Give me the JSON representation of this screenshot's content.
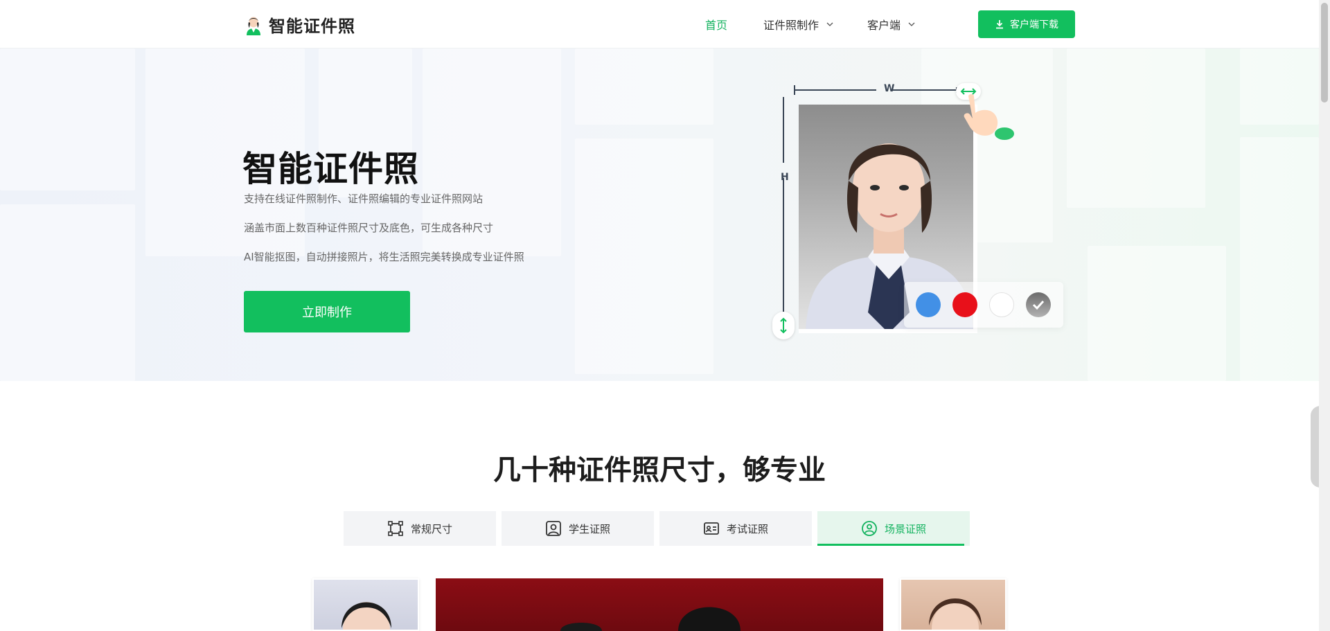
{
  "header": {
    "logo_text": "智能证件照",
    "nav": [
      {
        "label": "首页",
        "active": true
      },
      {
        "label": "证件照制作",
        "dropdown": true
      },
      {
        "label": "客户端",
        "dropdown": true
      }
    ],
    "download_label": "客户端下载"
  },
  "hero": {
    "title": "智能证件照",
    "lines": [
      "支持在线证件照制作、证件照编辑的专业证件照网站",
      "涵盖市面上数百种证件照尺寸及底色，可生成各种尺寸",
      "AI智能抠图，自动拼接照片，将生活照完美转换成专业证件照"
    ],
    "cta_label": "立即制作",
    "illustration": {
      "width_label": "W",
      "height_label": "H",
      "swatches": [
        {
          "name": "blue",
          "color": "#4290e6"
        },
        {
          "name": "red",
          "color": "#e8101a"
        },
        {
          "name": "white",
          "color": "#ffffff"
        },
        {
          "name": "gray-selected",
          "color": "#8a8a8a",
          "selected": true
        }
      ]
    }
  },
  "section": {
    "title": "几十种证件照尺寸，够专业",
    "tabs": [
      {
        "label": "常规尺寸",
        "icon": "crop-frame-icon",
        "active": false
      },
      {
        "label": "学生证照",
        "icon": "portrait-icon",
        "active": false
      },
      {
        "label": "考试证照",
        "icon": "id-card-icon",
        "active": false
      },
      {
        "label": "场景证照",
        "icon": "scene-icon",
        "active": true
      }
    ]
  },
  "colors": {
    "brand_green": "#12bf5e",
    "active_nav": "#12b25e"
  }
}
